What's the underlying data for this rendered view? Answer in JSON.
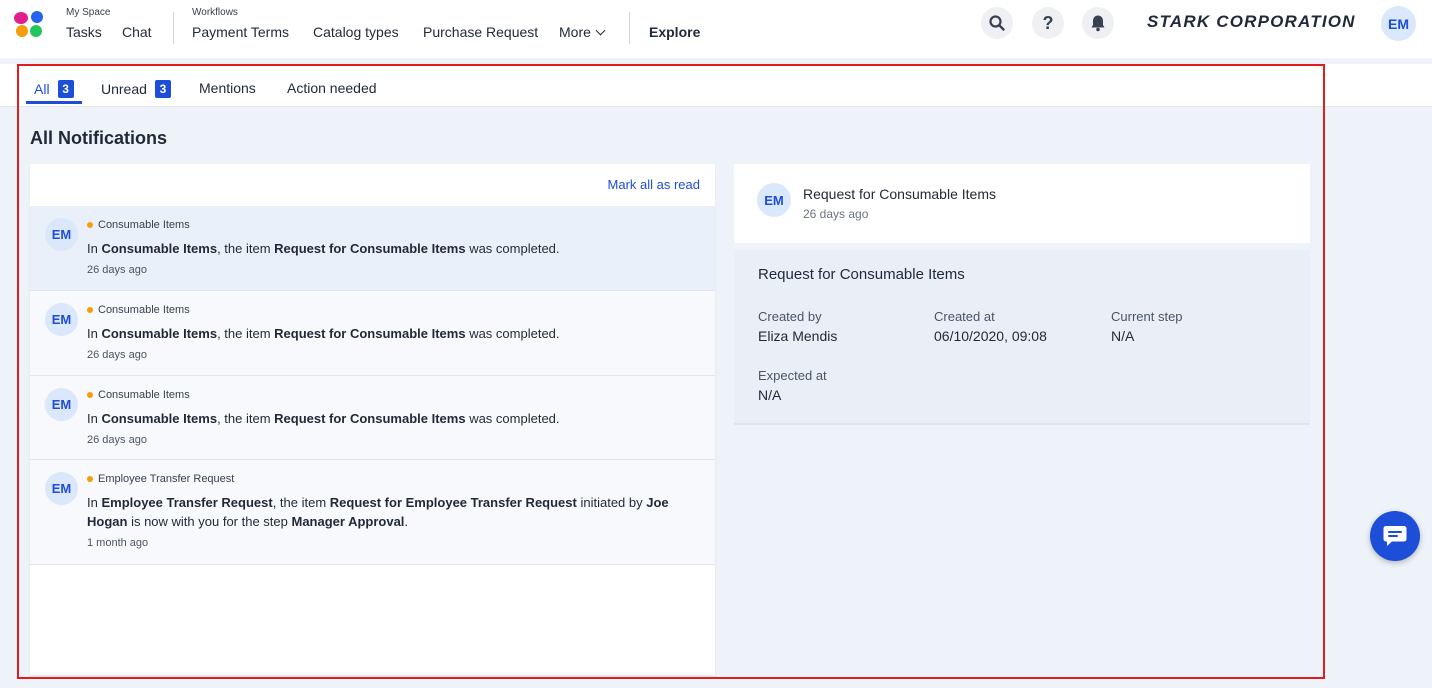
{
  "nav": {
    "myspace_label": "My Space",
    "tasks": "Tasks",
    "chat": "Chat",
    "workflows_label": "Workflows",
    "payment_terms": "Payment Terms",
    "catalog_types": "Catalog types",
    "purchase_request": "Purchase Request",
    "more": "More",
    "explore": "Explore",
    "brand": "STARK CORPORATION",
    "user_initials": "EM"
  },
  "tabs": [
    {
      "label": "All",
      "badge": "3",
      "active": true
    },
    {
      "label": "Unread",
      "badge": "3"
    },
    {
      "label": "Mentions"
    },
    {
      "label": "Action needed"
    }
  ],
  "page_title": "All Notifications",
  "mark_all": "Mark all as read",
  "notifications": [
    {
      "initials": "EM",
      "category": "Consumable Items",
      "p1": "In ",
      "b1": "Consumable Items",
      "p2": ", the item ",
      "b2": "Request for Consumable Items",
      "p3": " was completed.",
      "time": "26 days ago"
    },
    {
      "initials": "EM",
      "category": "Consumable Items",
      "p1": "In ",
      "b1": "Consumable Items",
      "p2": ", the item ",
      "b2": "Request for Consumable Items",
      "p3": " was completed.",
      "time": "26 days ago"
    },
    {
      "initials": "EM",
      "category": "Consumable Items",
      "p1": "In ",
      "b1": "Consumable Items",
      "p2": ", the item ",
      "b2": "Request for Consumable Items",
      "p3": " was completed.",
      "time": "26 days ago"
    },
    {
      "initials": "EM",
      "category": "Employee Transfer Request",
      "p1": "In ",
      "b1": "Employee Transfer Request",
      "p2": ", the item ",
      "b2": "Request for Employee Transfer Request",
      "p3": " initiated by ",
      "b3": "Joe Hogan",
      "p4": " is now with you for the step ",
      "b4": "Manager Approval",
      "p5": ".",
      "time": "1 month ago"
    }
  ],
  "detail": {
    "initials": "EM",
    "title": "Request for Consumable Items",
    "time": "26 days ago",
    "body_title": "Request for Consumable Items",
    "created_by_label": "Created by",
    "created_by": "Eliza Mendis",
    "created_at_label": "Created at",
    "created_at": "06/10/2020, 09:08",
    "current_step_label": "Current step",
    "current_step": "N/A",
    "expected_at_label": "Expected at",
    "expected_at": "N/A"
  },
  "colors": {
    "accent": "#1d4ed8",
    "dot": "#f59e0b",
    "highlight": "#e11d1d"
  }
}
